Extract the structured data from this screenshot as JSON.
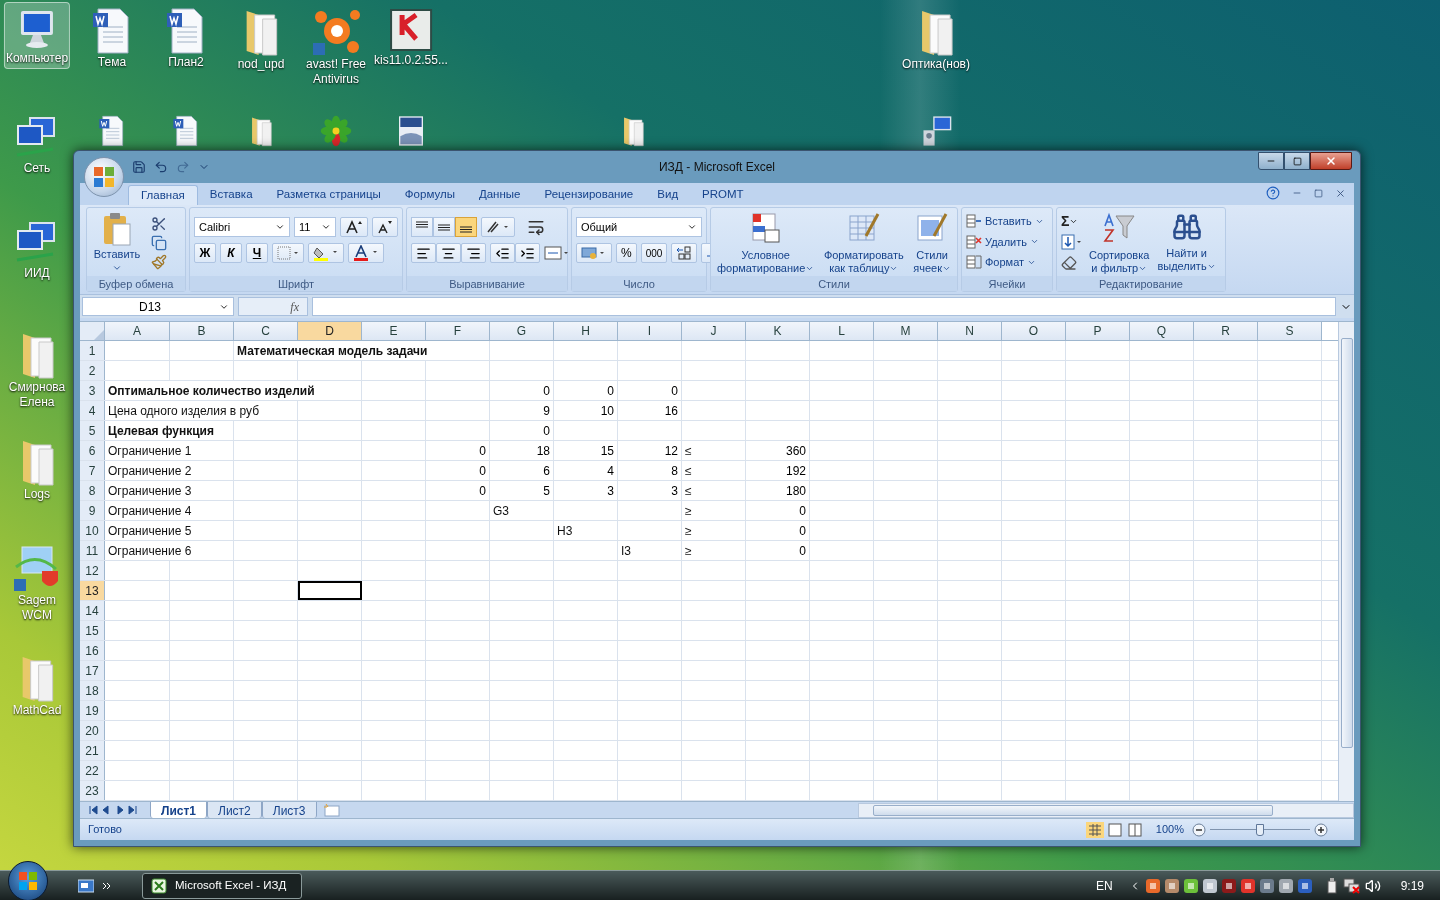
{
  "desktop": {
    "icons": [
      {
        "kind": "computer",
        "label": "Компьютер",
        "selected": true
      },
      {
        "kind": "document",
        "label": "Тема",
        "selected": false
      },
      {
        "kind": "document",
        "label": "План2",
        "selected": false
      },
      {
        "kind": "folder",
        "label": "nod_upd",
        "selected": false
      },
      {
        "kind": "antivirus",
        "label": "avast! Free Antivirus",
        "selected": false
      },
      {
        "kind": "shield",
        "label": "kis11.0.2.55...",
        "selected": false
      },
      {
        "kind": "folder",
        "label": "Оптика(нов)",
        "selected": false
      },
      {
        "kind": "network",
        "label": "Сеть",
        "selected": false
      },
      {
        "kind": "document",
        "selected": false
      },
      {
        "kind": "document",
        "selected": false
      },
      {
        "kind": "folder",
        "selected": false
      },
      {
        "kind": "flower",
        "selected": false
      },
      {
        "kind": "book",
        "selected": false
      },
      {
        "kind": "folder",
        "selected": false
      },
      {
        "kind": "netpc",
        "selected": false
      },
      {
        "kind": "network",
        "label": "ИИД",
        "selected": false
      },
      {
        "kind": "folder",
        "label": "Смирнова Елена",
        "selected": false
      },
      {
        "kind": "folder",
        "label": "Logs",
        "selected": false
      },
      {
        "kind": "monitor",
        "label": "Sagem WCM",
        "selected": false
      },
      {
        "kind": "folder",
        "label": "MathCad",
        "selected": false
      }
    ]
  },
  "window": {
    "title": "ИЗД - Microsoft Excel",
    "tabs": [
      {
        "label": "Главная",
        "selected": true
      },
      {
        "label": "Вставка",
        "selected": false
      },
      {
        "label": "Разметка страницы",
        "selected": false
      },
      {
        "label": "Формулы",
        "selected": false
      },
      {
        "label": "Данные",
        "selected": false
      },
      {
        "label": "Рецензирование",
        "selected": false
      },
      {
        "label": "Вид",
        "selected": false
      },
      {
        "label": "PROMT",
        "selected": false
      }
    ],
    "ribbon": {
      "groups": [
        {
          "kind": "clipboard",
          "title": "Буфер обмена",
          "paste": "Вставить"
        },
        {
          "kind": "font",
          "title": "Шрифт",
          "font": "Calibri",
          "size": "11",
          "bold": "Ж",
          "italic": "К",
          "underline": "Ч"
        },
        {
          "kind": "alignment",
          "title": "Выравнивание",
          "vertical": [
            {
              "kind": "top",
              "selected": false
            },
            {
              "kind": "middle",
              "selected": false
            },
            {
              "kind": "bottom",
              "selected": true
            }
          ]
        },
        {
          "kind": "number",
          "title": "Число",
          "format": "Общий",
          "percent": "%",
          "thousands": "000"
        },
        {
          "kind": "styles",
          "title": "Стили",
          "buttons": [
            {
              "kind": "conditional",
              "lines": [
                "Условное",
                "форматирование"
              ]
            },
            {
              "kind": "table",
              "lines": [
                "Форматировать",
                "как таблицу"
              ]
            },
            {
              "kind": "cellstyle",
              "lines": [
                "Стили",
                "ячеек"
              ]
            }
          ]
        },
        {
          "kind": "cells",
          "title": "Ячейки",
          "buttons": [
            {
              "kind": "insert",
              "label": "Вставить"
            },
            {
              "kind": "delete",
              "label": "Удалить"
            },
            {
              "kind": "format",
              "label": "Формат"
            }
          ]
        },
        {
          "kind": "editing",
          "title": "Редактирование",
          "sum": "Σ",
          "buttons": [
            {
              "kind": "sort",
              "lines": [
                "Сортировка",
                "и фильтр"
              ]
            },
            {
              "kind": "find",
              "lines": [
                "Найти и",
                "выделить"
              ]
            }
          ]
        }
      ]
    },
    "formula_bar": {
      "name_box": "D13",
      "function_label": "fx"
    },
    "sheet": {
      "columns": [
        {
          "label": "A",
          "selected": false
        },
        {
          "label": "B",
          "selected": false
        },
        {
          "label": "C",
          "selected": false
        },
        {
          "label": "D",
          "selected": true
        },
        {
          "label": "E",
          "selected": false
        },
        {
          "label": "F",
          "selected": false
        },
        {
          "label": "G",
          "selected": false
        },
        {
          "label": "H",
          "selected": false
        },
        {
          "label": "I",
          "selected": false
        },
        {
          "label": "J",
          "selected": false
        },
        {
          "label": "K",
          "selected": false
        },
        {
          "label": "L",
          "selected": false
        },
        {
          "label": "M",
          "selected": false
        },
        {
          "label": "N",
          "selected": false
        },
        {
          "label": "O",
          "selected": false
        },
        {
          "label": "P",
          "selected": false
        },
        {
          "label": "Q",
          "selected": false
        },
        {
          "label": "R",
          "selected": false
        },
        {
          "label": "S",
          "selected": false
        }
      ],
      "rows": [
        {
          "number": "1",
          "selected": false,
          "cells": {
            "C": {
              "text": "Математическая модель задачи",
              "kind": "text",
              "bold": true
            }
          }
        },
        {
          "number": "2",
          "selected": false
        },
        {
          "number": "3",
          "selected": false,
          "cells": {
            "A": {
              "text": "Оптимальное количество изделий",
              "kind": "text",
              "bold": true
            },
            "G": {
              "text": "0",
              "kind": "number",
              "bold": false
            },
            "H": {
              "text": "0",
              "kind": "number",
              "bold": false
            },
            "I": {
              "text": "0",
              "kind": "number",
              "bold": false
            }
          }
        },
        {
          "number": "4",
          "selected": false,
          "cells": {
            "A": {
              "text": "Цена одного изделия в руб",
              "kind": "text",
              "bold": false
            },
            "G": {
              "text": "9",
              "kind": "number",
              "bold": false
            },
            "H": {
              "text": "10",
              "kind": "number",
              "bold": false
            },
            "I": {
              "text": "16",
              "kind": "number",
              "bold": false
            }
          }
        },
        {
          "number": "5",
          "selected": false,
          "cells": {
            "A": {
              "text": "Целевая функция",
              "kind": "text",
              "bold": true
            },
            "G": {
              "text": "0",
              "kind": "number",
              "bold": false
            }
          }
        },
        {
          "number": "6",
          "selected": false,
          "cells": {
            "A": {
              "text": "Ограничение 1",
              "kind": "text",
              "bold": false
            },
            "F": {
              "text": "0",
              "kind": "number",
              "bold": false
            },
            "G": {
              "text": "18",
              "kind": "number",
              "bold": false
            },
            "H": {
              "text": "15",
              "kind": "number",
              "bold": false
            },
            "I": {
              "text": "12",
              "kind": "number",
              "bold": false
            },
            "J": {
              "text": "≤",
              "kind": "text",
              "bold": false
            },
            "K": {
              "text": "360",
              "kind": "number",
              "bold": false
            }
          }
        },
        {
          "number": "7",
          "selected": false,
          "cells": {
            "A": {
              "text": "Ограничение 2",
              "kind": "text",
              "bold": false
            },
            "F": {
              "text": "0",
              "kind": "number",
              "bold": false
            },
            "G": {
              "text": "6",
              "kind": "number",
              "bold": false
            },
            "H": {
              "text": "4",
              "kind": "number",
              "bold": false
            },
            "I": {
              "text": "8",
              "kind": "number",
              "bold": false
            },
            "J": {
              "text": "≤",
              "kind": "text",
              "bold": false
            },
            "K": {
              "text": "192",
              "kind": "number",
              "bold": false
            }
          }
        },
        {
          "number": "8",
          "selected": false,
          "cells": {
            "A": {
              "text": "Ограничение 3",
              "kind": "text",
              "bold": false
            },
            "F": {
              "text": "0",
              "kind": "number",
              "bold": false
            },
            "G": {
              "text": "5",
              "kind": "number",
              "bold": false
            },
            "H": {
              "text": "3",
              "kind": "number",
              "bold": false
            },
            "I": {
              "text": "3",
              "kind": "number",
              "bold": false
            },
            "J": {
              "text": "≤",
              "kind": "text",
              "bold": false
            },
            "K": {
              "text": "180",
              "kind": "number",
              "bold": false
            }
          }
        },
        {
          "number": "9",
          "selected": false,
          "cells": {
            "A": {
              "text": "Ограничение 4",
              "kind": "text",
              "bold": false
            },
            "G": {
              "text": "G3",
              "kind": "text",
              "bold": false
            },
            "J": {
              "text": "≥",
              "kind": "text",
              "bold": false
            },
            "K": {
              "text": "0",
              "kind": "number",
              "bold": false
            }
          }
        },
        {
          "number": "10",
          "selected": false,
          "cells": {
            "A": {
              "text": "Ограничение 5",
              "kind": "text",
              "bold": false
            },
            "H": {
              "text": "H3",
              "kind": "text",
              "bold": false
            },
            "J": {
              "text": "≥",
              "kind": "text",
              "bold": false
            },
            "K": {
              "text": "0",
              "kind": "number",
              "bold": false
            }
          }
        },
        {
          "number": "11",
          "selected": false,
          "cells": {
            "A": {
              "text": "Ограничение 6",
              "kind": "text",
              "bold": false
            },
            "I": {
              "text": "I3",
              "kind": "text",
              "bold": false
            },
            "J": {
              "text": "≥",
              "kind": "text",
              "bold": false
            },
            "K": {
              "text": "0",
              "kind": "number",
              "bold": false
            }
          }
        },
        {
          "number": "12",
          "selected": false
        },
        {
          "number": "13",
          "selected": true
        },
        {
          "number": "14",
          "selected": false
        },
        {
          "number": "15",
          "selected": false
        },
        {
          "number": "16",
          "selected": false
        },
        {
          "number": "17",
          "selected": false
        },
        {
          "number": "18",
          "selected": false
        },
        {
          "number": "19",
          "selected": false
        },
        {
          "number": "20",
          "selected": false
        },
        {
          "number": "21",
          "selected": false
        },
        {
          "number": "22",
          "selected": false
        },
        {
          "number": "23",
          "selected": false
        }
      ],
      "sheet_tabs": [
        {
          "label": "Лист1",
          "selected": true
        },
        {
          "label": "Лист2",
          "selected": false
        },
        {
          "label": "Лист3",
          "selected": false
        }
      ]
    },
    "status_bar": {
      "status": "Готово",
      "zoom": "100%",
      "zoom_slider": {
        "level": 0.5
      }
    }
  },
  "taskbar": {
    "tasks": [
      {
        "label": "Microsoft Excel - ИЗД",
        "selected": true
      }
    ],
    "language": "EN",
    "clock": "9:19"
  }
}
